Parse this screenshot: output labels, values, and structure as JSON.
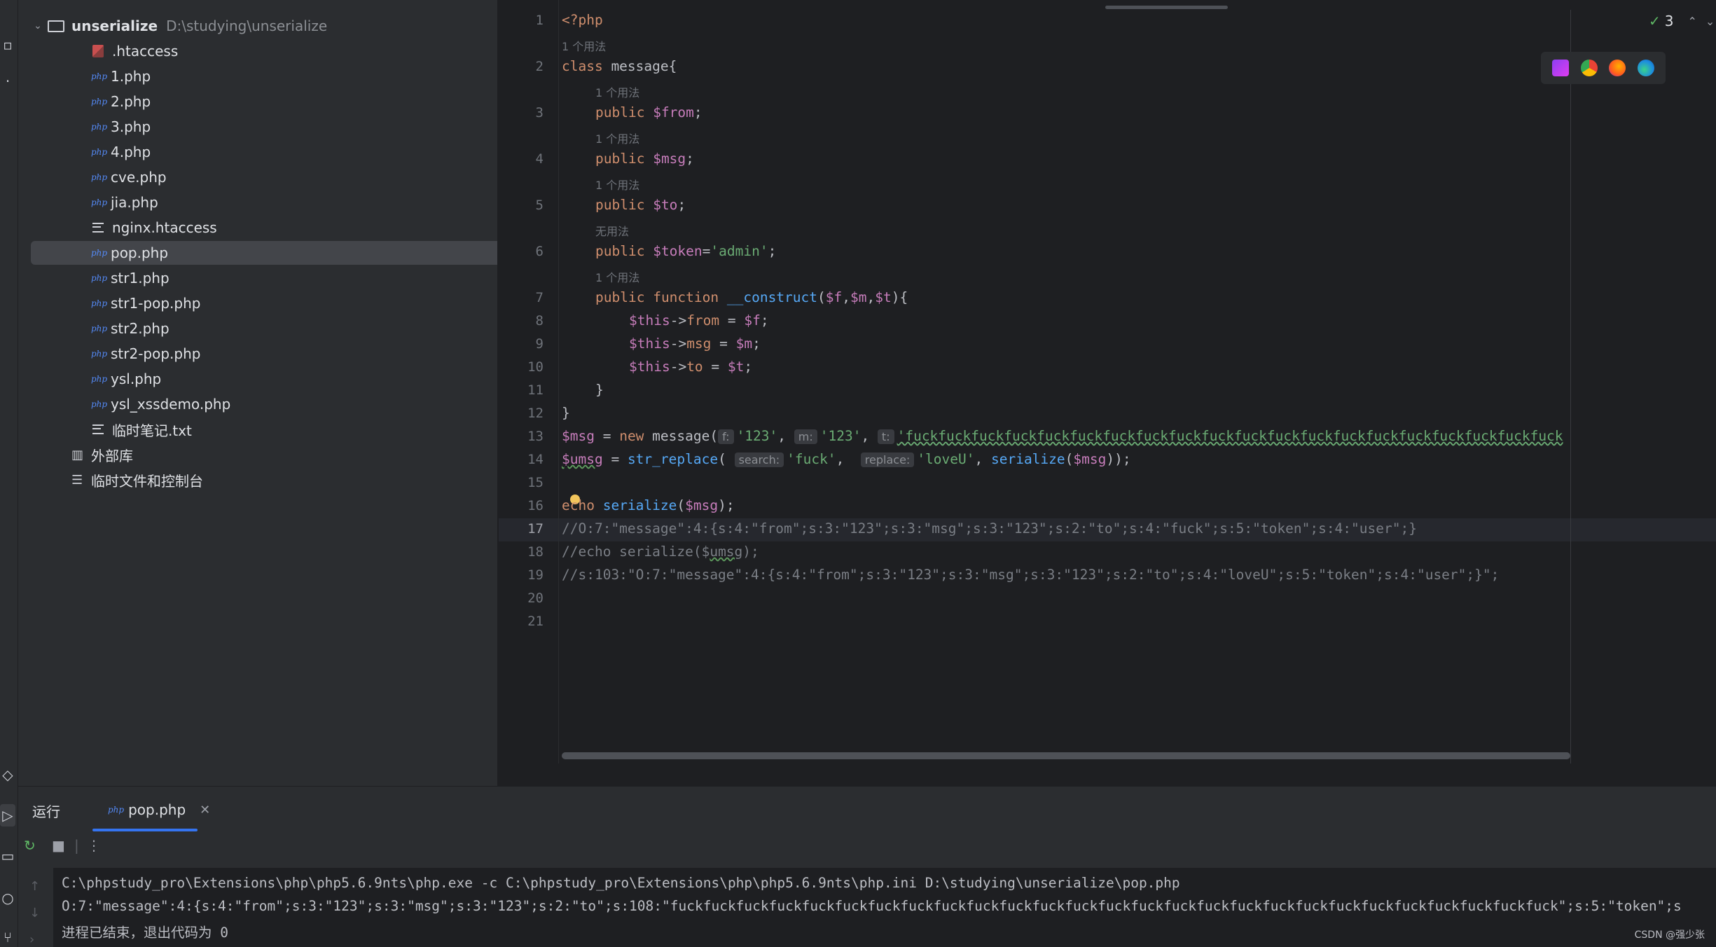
{
  "project": {
    "root_name": "unserialize",
    "root_path": "D:\\studying\\unserialize",
    "files": [
      {
        "name": ".htaccess",
        "icon": "htaccess-icon"
      },
      {
        "name": "1.php",
        "icon": "php-icon"
      },
      {
        "name": "2.php",
        "icon": "php-icon"
      },
      {
        "name": "3.php",
        "icon": "php-icon"
      },
      {
        "name": "4.php",
        "icon": "php-icon"
      },
      {
        "name": "cve.php",
        "icon": "php-icon"
      },
      {
        "name": "jia.php",
        "icon": "php-icon"
      },
      {
        "name": "nginx.htaccess",
        "icon": "text-file-icon"
      },
      {
        "name": "pop.php",
        "icon": "php-icon",
        "selected": true
      },
      {
        "name": "str1.php",
        "icon": "php-icon"
      },
      {
        "name": "str1-pop.php",
        "icon": "php-icon"
      },
      {
        "name": "str2.php",
        "icon": "php-icon"
      },
      {
        "name": "str2-pop.php",
        "icon": "php-icon"
      },
      {
        "name": "ysl.php",
        "icon": "php-icon"
      },
      {
        "name": "ysl_xssdemo.php",
        "icon": "php-icon"
      },
      {
        "name": "临时笔记.txt",
        "icon": "text-file-icon"
      }
    ],
    "external_libs": "外部库",
    "scratches": "临时文件和控制台",
    "php_icon_text": "php"
  },
  "editor": {
    "line_numbers": [
      "1",
      "2",
      "3",
      "4",
      "5",
      "6",
      "7",
      "8",
      "9",
      "10",
      "11",
      "12",
      "13",
      "14",
      "15",
      "16",
      "17",
      "18",
      "19",
      "20",
      "21"
    ],
    "current_line": "17",
    "usage_hints": {
      "one_usage": "1 个用法",
      "no_usage": "无用法"
    },
    "code": {
      "l1": "<?php",
      "l2_kw": "class",
      "l2_rest": " message{",
      "l3_kw": "public",
      "l3_var": "$from",
      "l4_kw": "public",
      "l4_var": "$msg",
      "l5_kw": "public",
      "l5_var": "$to",
      "l6_kw": "public",
      "l6_var": "$token",
      "l6_str": "'admin'",
      "l7_kw1": "public",
      "l7_kw2": "function",
      "l7_fn": "__construct",
      "l8_var1": "$this",
      "l8_prop": "from",
      "l8_var2": "$f",
      "l9_var1": "$this",
      "l9_prop": "msg",
      "l9_var2": "$m",
      "l10_var1": "$this",
      "l10_prop": "to",
      "l10_var2": "$t",
      "l11": "}",
      "l12": "}",
      "l13_var": "$msg",
      "l13_kw": "new",
      "l13_cls": " message(",
      "l13_h1": "f:",
      "l13_s1": "'123'",
      "l13_h2": "m:",
      "l13_s2": "'123'",
      "l13_h3": "t:",
      "l13_s3": "'fuckfuckfuckfuckfuckfuckfuckfuckfuckfuckfuckfuckfuckfuckfuckfuckfuckfuckfuckfuck",
      "l14_var": "$umsg",
      "l14_fn": "str_replace",
      "l14_h1": "search:",
      "l14_s1": "'fuck'",
      "l14_h2": "replace:",
      "l14_s2": "'loveU'",
      "l14_fn2": "serialize",
      "l14_var2": "$msg",
      "l16_kw": "echo",
      "l16_fn": "serialize",
      "l16_var": "$msg",
      "l17": "//O:7:\"message\":4:{s:4:\"from\";s:3:\"123\";s:3:\"msg\";s:3:\"123\";s:2:\"to\";s:4:\"fuck\";s:5:\"token\";s:4:\"user\";}",
      "l18_a": "//echo serialize($",
      "l18_b": "umsg",
      "l18_c": ");",
      "l19": "//s:103:\"O:7:\"message\":4:{s:4:\"from\";s:3:\"123\";s:3:\"msg\";s:3:\"123\";s:2:\"to\";s:4:\"loveU\";s:5:\"token\";s:4:\"user\";}\";"
    },
    "inspections_count": "3"
  },
  "run_panel": {
    "title": "运行",
    "tab_label": "pop.php",
    "tab_icon_text": "php",
    "console_lines": [
      "C:\\phpstudy_pro\\Extensions\\php\\php5.6.9nts\\php.exe -c C:\\phpstudy_pro\\Extensions\\php\\php5.6.9nts\\php.ini D:\\studying\\unserialize\\pop.php",
      "O:7:\"message\":4:{s:4:\"from\";s:3:\"123\";s:3:\"msg\";s:3:\"123\";s:2:\"to\";s:108:\"fuckfuckfuckfuckfuckfuckfuckfuckfuckfuckfuckfuckfuckfuckfuckfuckfuckfuckfuckfuckfuckfuckfuckfuckfuckfuckfuck\";s:5:\"token\";s",
      "进程已结束，退出代码为 0"
    ]
  },
  "watermark": "CSDN @强少张",
  "colors": {
    "background": "#1e1f22",
    "panel": "#2b2d30",
    "keyword": "#cf8e6d",
    "variable": "#c77dbb",
    "string": "#6aab73",
    "function": "#56a8f5",
    "comment": "#7a7e85",
    "accent": "#3574f0"
  }
}
